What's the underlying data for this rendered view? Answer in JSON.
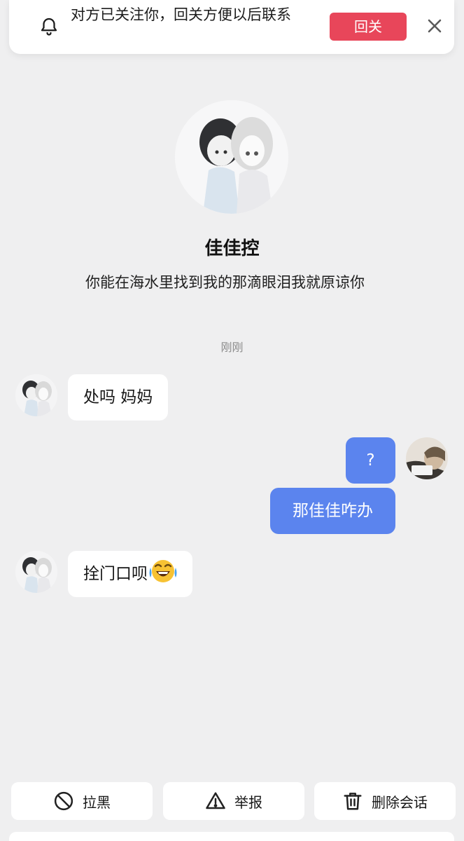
{
  "banner": {
    "text": "对方已关注你，回关方便以后联系",
    "follow_back_label": "回关",
    "icons": {
      "bell": "bell-icon",
      "close": "close-icon"
    }
  },
  "profile": {
    "name": "佳佳控",
    "bio": "你能在海水里找到我的那滴眼泪我就原谅你"
  },
  "chat": {
    "time_label": "刚刚",
    "messages": [
      {
        "direction": "incoming",
        "text": "处吗 妈妈"
      },
      {
        "direction": "outgoing",
        "text": "?"
      },
      {
        "direction": "outgoing",
        "text": "那佳佳咋办"
      },
      {
        "direction": "incoming",
        "text": "拴门口呗",
        "emoji": "laughing-crying-emoji"
      }
    ]
  },
  "actions": [
    {
      "label": "拉黑",
      "icon": "block-icon"
    },
    {
      "label": "举报",
      "icon": "warning-icon"
    },
    {
      "label": "删除会话",
      "icon": "trash-icon"
    }
  ],
  "colors": {
    "background": "#efeff0",
    "accent_red": "#e8465a",
    "bubble_blue": "#5b84ee",
    "bubble_white": "#ffffff"
  }
}
